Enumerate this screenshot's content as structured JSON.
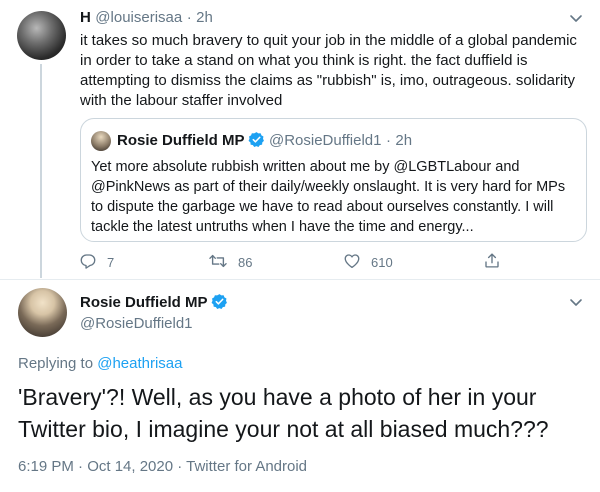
{
  "reply_tweet": {
    "name": "H",
    "handle": "@louiserisaa",
    "separator": "·",
    "time": "2h",
    "text": "it takes so much bravery to quit your job in the middle of a global pandemic in order to take a stand on what you think is right. the fact duffield is attempting to dismiss the claims as \"rubbish\" is, imo, outrageous. solidarity with the labour staffer involved",
    "quoted": {
      "name": "Rosie Duffield MP",
      "handle": "@RosieDuffield1",
      "separator": "·",
      "time": "2h",
      "text": "Yet more absolute rubbish written about me by @LGBTLabour and @PinkNews as part of their daily/weekly onslaught. It is very hard for MPs to dispute the garbage we have to read about ourselves constantly. I will tackle the latest untruths when I have the time and energy..."
    },
    "actions": {
      "replies": "7",
      "retweets": "86",
      "likes": "610"
    }
  },
  "main_tweet": {
    "name": "Rosie Duffield MP",
    "handle": "@RosieDuffield1",
    "replying_to_label": "Replying to",
    "replying_to_handle": "@heathrisaa",
    "text": "'Bravery'?! Well, as you have a photo of her in your Twitter bio, I imagine your not at all biased much???",
    "timestamp": "6:19 PM · Oct 14, 2020 · Twitter for Android"
  },
  "icons": {
    "verified": "verified-badge-icon",
    "chevron": "chevron-down-icon",
    "reply": "reply-icon",
    "retweet": "retweet-icon",
    "like": "heart-icon",
    "share": "share-icon"
  },
  "colors": {
    "accent": "#1da1f2",
    "muted": "#657786",
    "text": "#14171a"
  }
}
